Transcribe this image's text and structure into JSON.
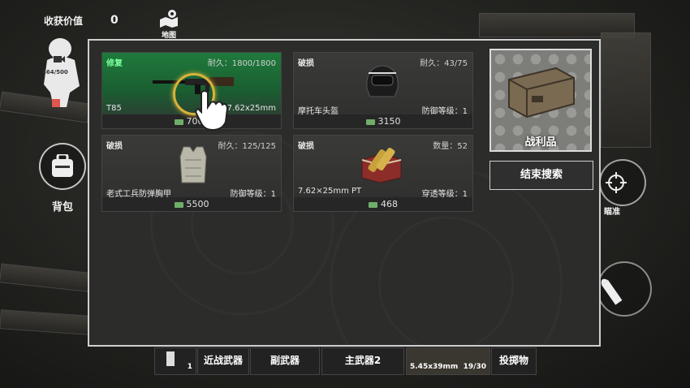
{
  "hud": {
    "harvest_label": "收获价值",
    "harvest_value": "0",
    "map_label": "地图",
    "stamina": "464/500",
    "backpack_label": "背包",
    "aim_label": "瞄准"
  },
  "items": [
    {
      "tag": "修复",
      "durability": "耐久：1800/1800",
      "name": "T85",
      "stat": "7.62x25mm",
      "price": "7000",
      "icon": "rifle-icon"
    },
    {
      "tag": "破损",
      "durability": "耐久：43/75",
      "name": "摩托车头盔",
      "stat": "防御等级：1",
      "price": "3150",
      "icon": "helmet-icon"
    },
    {
      "tag": "破损",
      "durability": "耐久：125/125",
      "name": "老式工兵防弹胸甲",
      "stat": "防御等级：1",
      "price": "5500",
      "icon": "armor-vest-icon"
    },
    {
      "tag": "破损",
      "durability": "数量：52",
      "name": "7.62×25mm PT",
      "stat": "穿透等级：1",
      "price": "468",
      "icon": "ammo-box-icon"
    }
  ],
  "loot": {
    "label": "战利品",
    "end_search": "结束搜索"
  },
  "bottom_bar": {
    "slot_count": "1",
    "melee": "近战武器",
    "secondary": "副武器",
    "primary2": "主武器2",
    "ammo": "5.45x39mm",
    "ammo_count": "19/30",
    "throwable": "投掷物"
  },
  "colors": {
    "highlight": "#1f7a3c",
    "panel": "#2c2c2a",
    "border": "#cfcfcf"
  }
}
